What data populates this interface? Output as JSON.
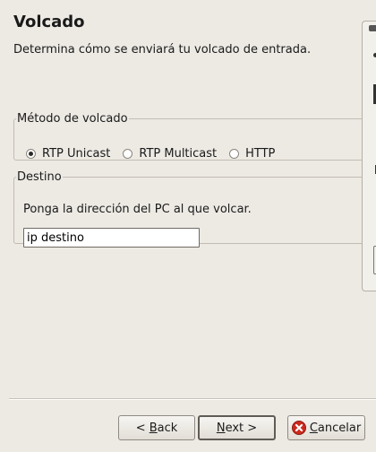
{
  "header": {
    "title": "Volcado",
    "subtitle": "Determina cómo se enviará tu volcado de entrada."
  },
  "method": {
    "legend": "Método de volcado",
    "options": [
      {
        "label": "RTP Unicast",
        "selected": true
      },
      {
        "label": "RTP Multicast",
        "selected": false
      },
      {
        "label": "HTTP",
        "selected": false
      }
    ]
  },
  "destination": {
    "legend": "Destino",
    "instruction": "Ponga la dirección del PC al que volcar.",
    "input_value": "ip destino"
  },
  "buttons": {
    "back_prefix": "< ",
    "back_mnemonic": "B",
    "back_rest": "ack",
    "next_prefix": "",
    "next_mnemonic": "N",
    "next_rest": "ext >",
    "cancel_prefix": "",
    "cancel_mnemonic": "C",
    "cancel_rest": "ancelar",
    "cancel_icon_color": "#cc2a1e"
  }
}
